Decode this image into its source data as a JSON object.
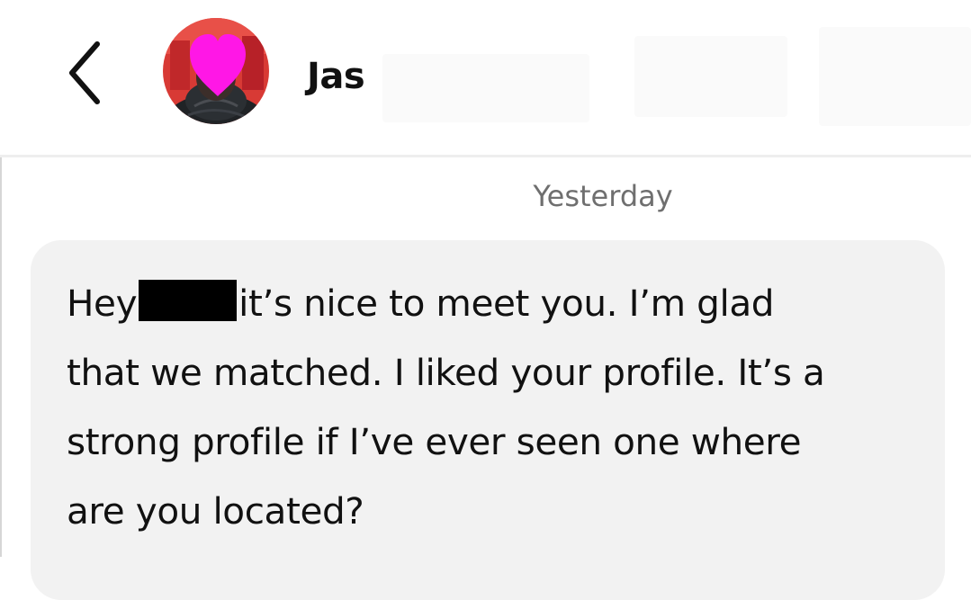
{
  "header": {
    "contact_name": "Jas"
  },
  "conversation": {
    "timestamp": "Yesterday",
    "messages": [
      {
        "greeting": "Hey",
        "redacted": true,
        "line1_rest": "it’s nice to meet you. I’m glad",
        "line2": "that we matched. I liked your profile. It’s a",
        "line3": "strong profile if I’ve ever seen one where",
        "line4": "are you located?"
      }
    ]
  },
  "icons": {
    "back": "chevron-left-icon",
    "avatar_mask": "heart-icon"
  },
  "colors": {
    "bubble": "#f2f2f2",
    "timestamp": "#6f6f6f",
    "heart": "#ff17e6",
    "redaction": "#000000"
  }
}
